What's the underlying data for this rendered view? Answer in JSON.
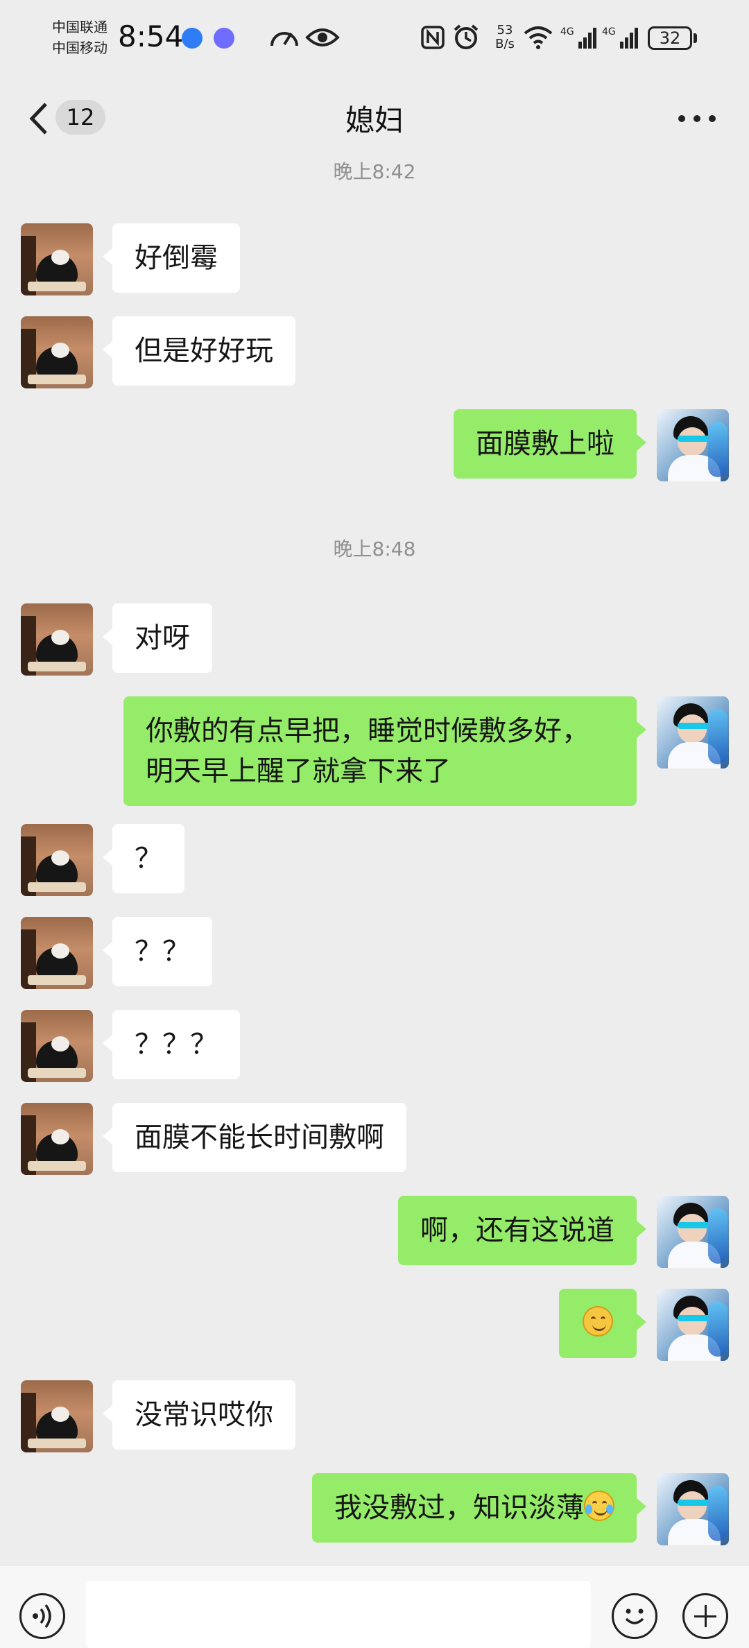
{
  "status_bar": {
    "carrier_1": "中国联通",
    "carrier_2": "中国移动",
    "time": "8:54",
    "net_speed_value": "53",
    "net_speed_unit": "B/s",
    "battery": "32",
    "icons": [
      "app-blue-icon",
      "music-icon",
      "speed-icon",
      "eye-icon",
      "nfc-icon",
      "alarm-icon",
      "wifi-icon",
      "signal-4g-icon",
      "signal-4g-icon"
    ]
  },
  "nav": {
    "back_count": "12",
    "title": "媳妇"
  },
  "chat": {
    "timestamps": [
      "晚上8:42",
      "晚上8:48"
    ],
    "messages": [
      {
        "side": "in",
        "text": "好倒霉"
      },
      {
        "side": "in",
        "text": "但是好好玩"
      },
      {
        "side": "out",
        "text": "面膜敷上啦"
      },
      {
        "side": "in",
        "text": "对呀"
      },
      {
        "side": "out",
        "text": "你敷的有点早把，睡觉时候敷多好，明天早上醒了就拿下来了"
      },
      {
        "side": "in",
        "text": "？"
      },
      {
        "side": "in",
        "text": "？？"
      },
      {
        "side": "in",
        "text": "？？？"
      },
      {
        "side": "in",
        "text": "面膜不能长时间敷啊"
      },
      {
        "side": "out",
        "text": "啊，还有这说道"
      },
      {
        "side": "out",
        "text": "",
        "emoji": "thinking-emoji-icon"
      },
      {
        "side": "in",
        "text": "没常识哎你"
      },
      {
        "side": "out",
        "text": "我没敷过，知识淡薄",
        "emoji": "laugh-cry-emoji-icon"
      }
    ]
  },
  "input": {
    "placeholder": ""
  },
  "colors": {
    "background": "#ededed",
    "outgoing_bubble": "#95ec69",
    "incoming_bubble": "#ffffff"
  }
}
